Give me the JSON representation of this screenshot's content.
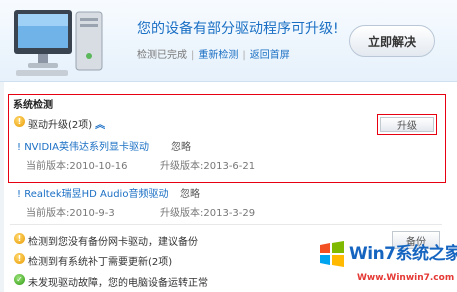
{
  "header": {
    "headline": "您的设备有部分驱动程序可升级!",
    "status": "检测已完成",
    "recheck_link": "重新检测",
    "back_link": "返回首屏",
    "fix_button": "立即解决"
  },
  "section": {
    "title": "系统检测"
  },
  "driver_upgrade": {
    "label": "驱动升级(2项)",
    "upgrade_button": "升级",
    "items": [
      {
        "name": "NVIDIA英伟达系列显卡驱动",
        "ignore": "忽略",
        "current": "当前版本:2010-10-16",
        "latest": "升级版本:2013-6-21"
      },
      {
        "name": "Realtek瑞昱HD Audio音频驱动",
        "ignore": "忽略",
        "current": "当前版本:2010-9-3",
        "latest": "升级版本:2013-3-29"
      }
    ]
  },
  "checks": [
    {
      "text": "检测到您没有备份网卡驱动，建议备份",
      "status": "warning",
      "button": "备份"
    },
    {
      "text": "检测到有系统补丁需要更新(2项)",
      "status": "warning"
    },
    {
      "text": "未发现驱动故障，您的电脑设备运转正常",
      "status": "ok"
    }
  ],
  "watermark": {
    "text": "Win7系统之家",
    "url": "Www.Winwin7.com"
  }
}
